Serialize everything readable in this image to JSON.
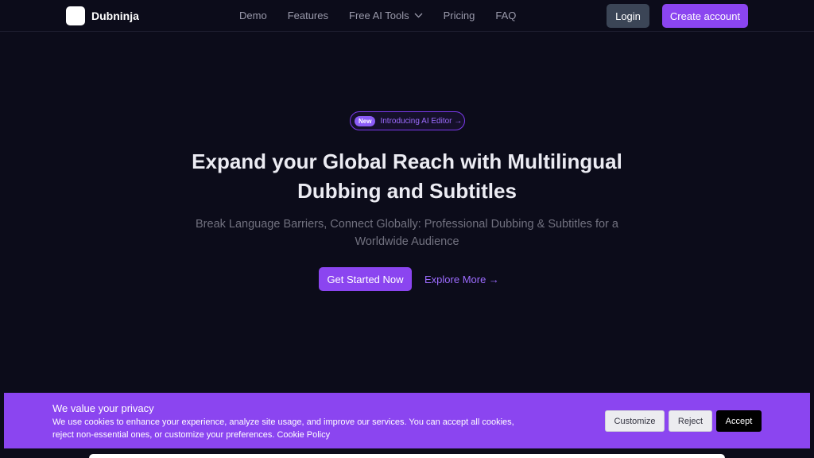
{
  "header": {
    "brand": "Dubninja",
    "nav": [
      {
        "label": "Demo"
      },
      {
        "label": "Features"
      },
      {
        "label": "Free AI Tools",
        "has_dropdown": true
      },
      {
        "label": "Pricing"
      },
      {
        "label": "FAQ"
      }
    ],
    "login_label": "Login",
    "create_account_label": "Create account"
  },
  "hero": {
    "badge_new": "New",
    "badge_text": "Introducing AI Editor →",
    "title": "Expand your Global Reach with Multilingual Dubbing and Subtitles",
    "subtitle": "Break Language Barriers, Connect Globally: Professional Dubbing & Subtitles for a Worldwide Audience",
    "primary_cta": "Get Started Now",
    "secondary_cta": "Explore More →"
  },
  "cookie_banner": {
    "title": "We value your privacy",
    "body": "We use cookies to enhance your experience, analyze site usage, and improve our services. You can accept all cookies, reject non-essential ones, or customize your preferences.",
    "policy_link": "Cookie Policy",
    "customize_label": "Customize",
    "reject_label": "Reject",
    "accept_label": "Accept"
  },
  "colors": {
    "background": "#0c0c1a",
    "accent": "#8b45f0",
    "login_bg": "#3b4556",
    "nav_text": "#9a9aab"
  },
  "icons": {
    "dropdown": "chevron-down-icon",
    "logo": "dubninja-logo-icon"
  }
}
